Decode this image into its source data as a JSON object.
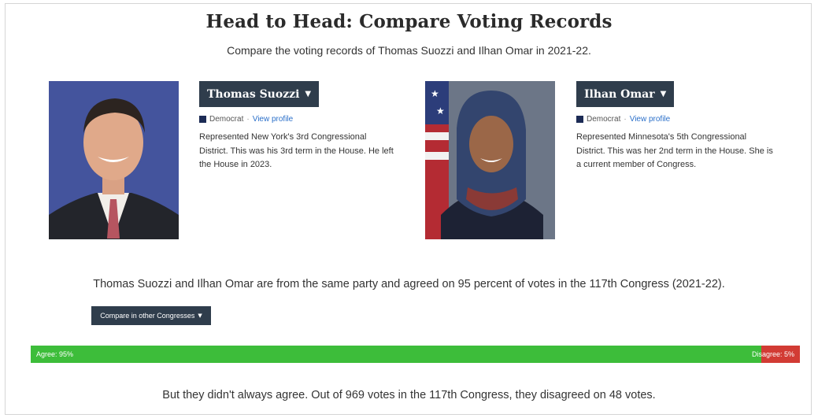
{
  "header": {
    "title": "Head to Head: Compare Voting Records",
    "subtitle": "Compare the voting records of Thomas Suozzi and Ilhan Omar in 2021-22."
  },
  "members": [
    {
      "name": "Thomas Suozzi",
      "party": "Democrat",
      "profile_link": "View profile",
      "bio": "Represented New York's 3rd Congressional District. This was his 3rd term in the House. He left the House in 2023."
    },
    {
      "name": "Ilhan Omar",
      "party": "Democrat",
      "profile_link": "View profile",
      "bio": "Represented Minnesota's 5th Congressional District. This was her 2nd term in the House. She is a current member of Congress."
    }
  ],
  "summary": "Thomas Suozzi and Ilhan Omar are from the same party and agreed on 95 percent of votes in the 117th Congress (2021-22).",
  "compare_button": "Compare in other Congresses",
  "agreement_bar": {
    "agree_label": "Agree: 95%",
    "disagree_label": "Disagree: 5%",
    "agree_fraction": 0.95,
    "agree_color": "#3dbd3a",
    "disagree_color": "#d23b34"
  },
  "footer_text": "But they didn't always agree. Out of 969 votes in the 117th Congress, they disagreed on 48 votes.",
  "colors": {
    "button_bg": "#2f3d4c",
    "democrat": "#1c2b55",
    "link": "#2a6fc9"
  }
}
